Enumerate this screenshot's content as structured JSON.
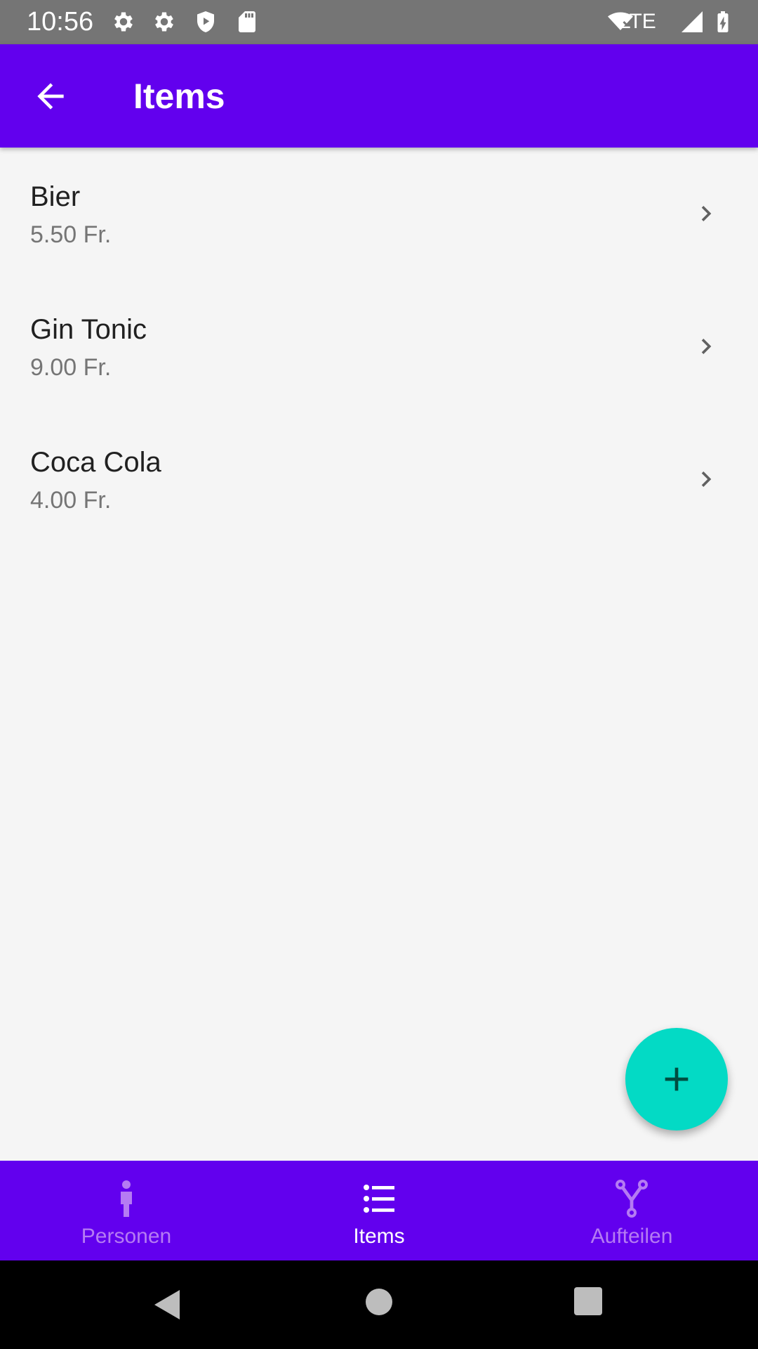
{
  "status_bar": {
    "time": "10:56",
    "icons": [
      "settings-icon",
      "settings-icon",
      "shield-play-icon",
      "sd-card-icon",
      "wifi-off-icon",
      "signal-icon",
      "battery-charging-icon"
    ],
    "network": "LTE"
  },
  "app_bar": {
    "title": "Items",
    "back_icon": "arrow-back-icon",
    "color": "#6200ee"
  },
  "items": [
    {
      "name": "Bier",
      "price": "5.50 Fr."
    },
    {
      "name": "Gin Tonic",
      "price": "9.00 Fr."
    },
    {
      "name": "Coca Cola",
      "price": "4.00 Fr."
    }
  ],
  "fab": {
    "icon": "plus-icon",
    "color": "#03dac5"
  },
  "bottom_nav": {
    "items": [
      {
        "label": "Personen",
        "icon": "person-icon",
        "active": false
      },
      {
        "label": "Items",
        "icon": "list-icon",
        "active": true
      },
      {
        "label": "Aufteilen",
        "icon": "call-split-icon",
        "active": false
      }
    ]
  },
  "system_nav": {
    "icons": [
      "back-triangle-icon",
      "home-circle-icon",
      "recents-square-icon"
    ]
  }
}
